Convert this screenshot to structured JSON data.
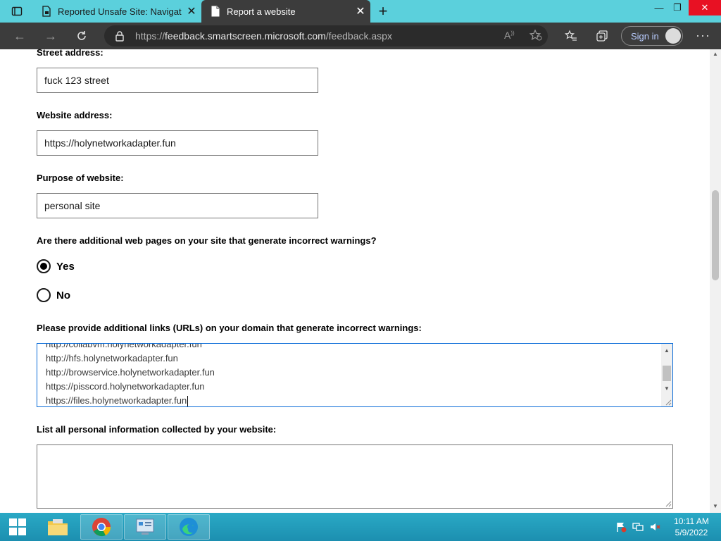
{
  "browser": {
    "tabs": [
      {
        "title": "Reported Unsafe Site: Navigation",
        "active": false
      },
      {
        "title": "Report a website",
        "active": true
      }
    ],
    "url_prefix": "https://",
    "url_domain": "feedback.smartscreen.microsoft.com",
    "url_path": "/feedback.aspx",
    "signin_label": "Sign in"
  },
  "form": {
    "street_label": "Street address:",
    "street_value": "fuck 123 street",
    "website_label": "Website address:",
    "website_value": "https://holynetworkadapter.fun",
    "purpose_label": "Purpose of website:",
    "purpose_value": "personal site",
    "additional_question": "Are there additional web pages on your site that generate incorrect warnings?",
    "radio_yes": "Yes",
    "radio_no": "No",
    "selected": "Yes",
    "links_label": "Please provide additional links (URLs) on your domain that generate incorrect warnings:",
    "links_lines": [
      "http://collabvm.holynetworkadapter.fun",
      "http://hfs.holynetworkadapter.fun",
      "http://browservice.holynetworkadapter.fun",
      "https://pisscord.holynetworkadapter.fun",
      "https://files.holynetworkadapter.fun"
    ],
    "personal_label": "List all personal information collected by your website:",
    "personal_value": ""
  },
  "taskbar": {
    "time": "10:11 AM",
    "date": "5/9/2022"
  }
}
